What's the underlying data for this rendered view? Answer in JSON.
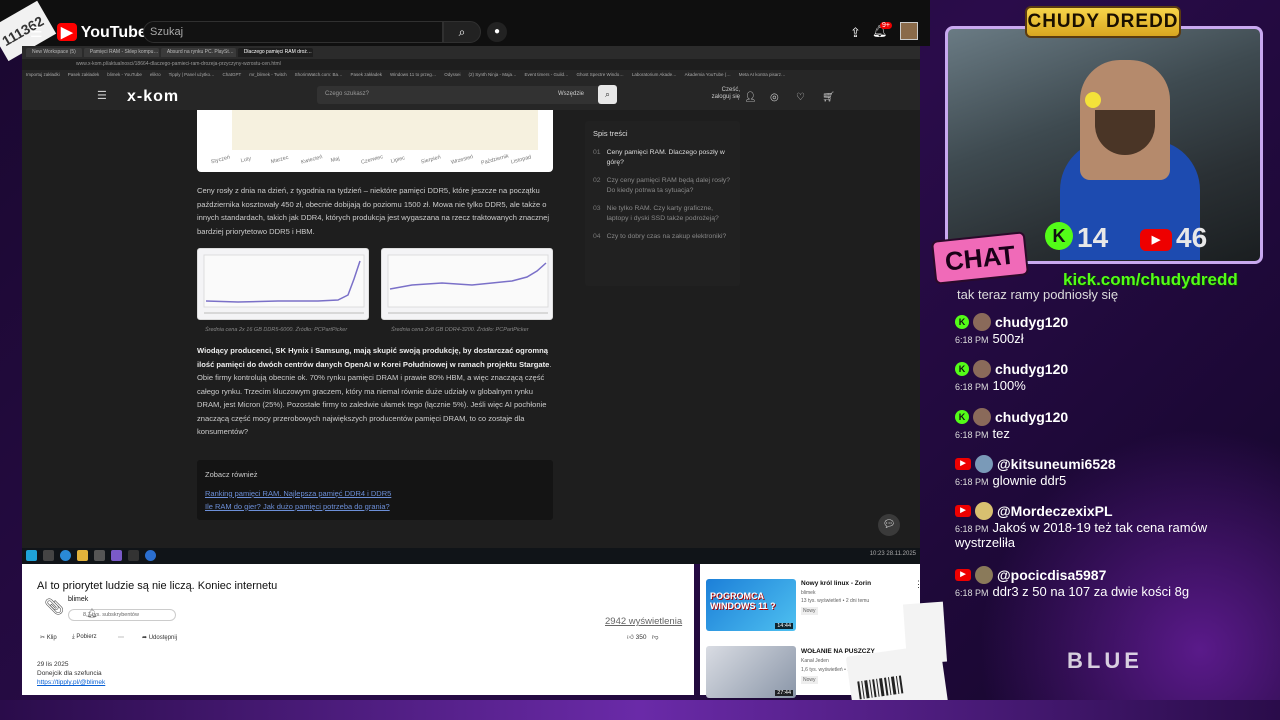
{
  "youtube": {
    "badge": "111362",
    "logo_text": "YouTube",
    "logo_region": "PL",
    "search_placeholder": "Szukaj",
    "notif_count": "9+"
  },
  "browser": {
    "tabs": [
      "New Workspace (5)",
      "Pamięci RAM - Sklep kompu…",
      "Absurd na rynku PC. PlaySt…",
      "Dlaczego pamięci RAM droż…"
    ],
    "url": "www.x-kom.pl/aktualnosci/18664-dlaczego-pamieci-ram-drozeja-przyczyny-wzrostu-cen.html",
    "bookmarks": [
      "Importuj zakładki",
      "Pasek zakładek",
      "blimek - YouTube",
      "elikro",
      "Tipply | Panel użytko…",
      "ChatGPT",
      "mr_blimek - Twitch",
      "ShorinWatch.com: Ba…",
      "Pasek zakładek",
      "Windows 11 to przeg…",
      "Odyssei",
      "(2) Synth Ninja - Maja…",
      "Event timers - Guild…",
      "Ghost Spectre Windo…",
      "Laboratorium Akade…",
      "Akademia YouTube (…",
      "Meta AI kontra pisarz…"
    ]
  },
  "xkom": {
    "logo": "x-kom",
    "search_placeholder": "Czego szukasz?",
    "search_category": "Wszędzie",
    "login_line1": "Cześć,",
    "login_line2": "zaloguj się"
  },
  "article": {
    "months": [
      "Styczeń",
      "Luty",
      "Marzec",
      "Kwiecień",
      "Maj",
      "Czerwiec",
      "Lipiec",
      "Sierpień",
      "Wrzesień",
      "Październik",
      "Listopad"
    ],
    "p1": "Ceny rosły z dnia na dzień, z tygodnia na tydzień – niektóre pamięci DDR5, które jeszcze na początku października kosztowały 450 zł, obecnie dobijają do poziomu 1500 zł. Mowa nie tylko DDR5, ale także o innych standardach, takich jak DDR4, których produkcja jest wygaszana na rzecz traktowanych znacznej bardziej priorytetowo DDR5 i HBM.",
    "cap1": "Średnia cena 2x 16 GB DDR5-6000. Źródło: PCPartPicker",
    "cap2": "Średnia cena 2x8 GB DDR4-3200. Źródło: PCPartPicker",
    "p2_bold": "Wiodący producenci, SK Hynix i Samsung, mają skupić swoją produkcję, by dostarczać ogromną ilość pamięci do dwóch centrów danych OpenAI w Korei Południowej w ramach projektu Stargate",
    "p2_rest": ". Obie firmy kontrolują obecnie ok. 70% rynku pamięci DRAM i prawie 80% HBM, a więc znaczącą część całego rynku. Trzecim kluczowym graczem, który ma niemal równie duże udziały w globalnym rynku DRAM, jest Micron (25%). Pozostałe firmy to zaledwie ułamek tego (łącznie 5%). Jeśli więc AI pochłonie znaczącą część mocy przerobowych największych producentów pamięci DRAM, to co zostaje dla konsumentów?",
    "see_also_title": "Zobacz również",
    "see_also_links": [
      "Ranking pamięci RAM. Najlepsza pamięć DDR4 i DDR5",
      "Ile RAM do gier? Jak dużo pamięci potrzeba do grania?"
    ]
  },
  "toc": {
    "title": "Spis treści",
    "items": [
      {
        "n": "01",
        "text": "Ceny pamięci RAM. Dlaczego poszły w górę?"
      },
      {
        "n": "02",
        "text": "Czy ceny pamięci RAM będą dalej rosły? Do kiedy potrwa ta sytuacja?"
      },
      {
        "n": "03",
        "text": "Nie tylko RAM. Czy karty graficzne, laptopy i dyski SSD także podrożeją?"
      },
      {
        "n": "04",
        "text": "Czy to dobry czas na zakup elektroniki?"
      }
    ]
  },
  "taskbar": {
    "time": "10:23",
    "date": "28.11.2025"
  },
  "video": {
    "title": "AI to priorytet ludzie są nie liczą. Koniec internetu",
    "channel": "blimek",
    "subscribers": "8,7 tys. subskrybentów",
    "views": "2942 wyświetlenia",
    "clip": "Klip",
    "download": "Pobierz",
    "share": "Udostępnij",
    "likes": "350",
    "date": "29 lis 2025",
    "desc": "Donejcik dla szefuncia",
    "link": "https://tipply.pl/@blimek"
  },
  "related": [
    {
      "title": "Nowy król linux - Zorin",
      "channel": "blimek",
      "meta": "13 tys. wyświetleń • 2 dni temu",
      "badge": "Nowy",
      "duration": "14:44",
      "thumb_text": "POGROMCA WINDOWS 11 ?"
    },
    {
      "title": "WOŁANIE NA PUSZCZY",
      "channel": "Kanał Jeden",
      "meta": "1,6 tys. wyświetleń • 1 godzinę temu",
      "badge": "Nowy",
      "duration": "27:44",
      "thumb_text": ""
    }
  ],
  "stream": {
    "name": "CHUDY DREDD",
    "kick_viewers": "14",
    "yt_viewers": "46",
    "chat_label": "CHAT",
    "kick_url": "kick.com/chudydredd",
    "ghost_text": "tak teraz ramy podniosły się",
    "bottom_logo": "BLUE"
  },
  "chat": [
    {
      "platform": "kick",
      "user": "chudyg120",
      "time": "6:18 PM",
      "text": "500zł"
    },
    {
      "platform": "kick",
      "user": "chudyg120",
      "time": "6:18 PM",
      "text": "100%"
    },
    {
      "platform": "kick",
      "user": "chudyg120",
      "time": "6:18 PM",
      "text": "tez"
    },
    {
      "platform": "yt",
      "user": "@kitsuneumi6528",
      "time": "6:18 PM",
      "text": "glownie ddr5"
    },
    {
      "platform": "yt",
      "user": "@MordeczexixPL",
      "time": "6:18 PM",
      "text": "Jakoś w 2018-19 też tak cena ramów wystrzeliła"
    },
    {
      "platform": "yt",
      "user": "@pocicdisa5987",
      "time": "6:18 PM",
      "text": "ddr3 z 50 na 107 za dwie kości 8g"
    }
  ],
  "colors": {
    "kick": "#53fc18",
    "youtube_red": "#ff0000",
    "chat_label": "#f06ab8",
    "name_plate": "#f7d54a"
  }
}
